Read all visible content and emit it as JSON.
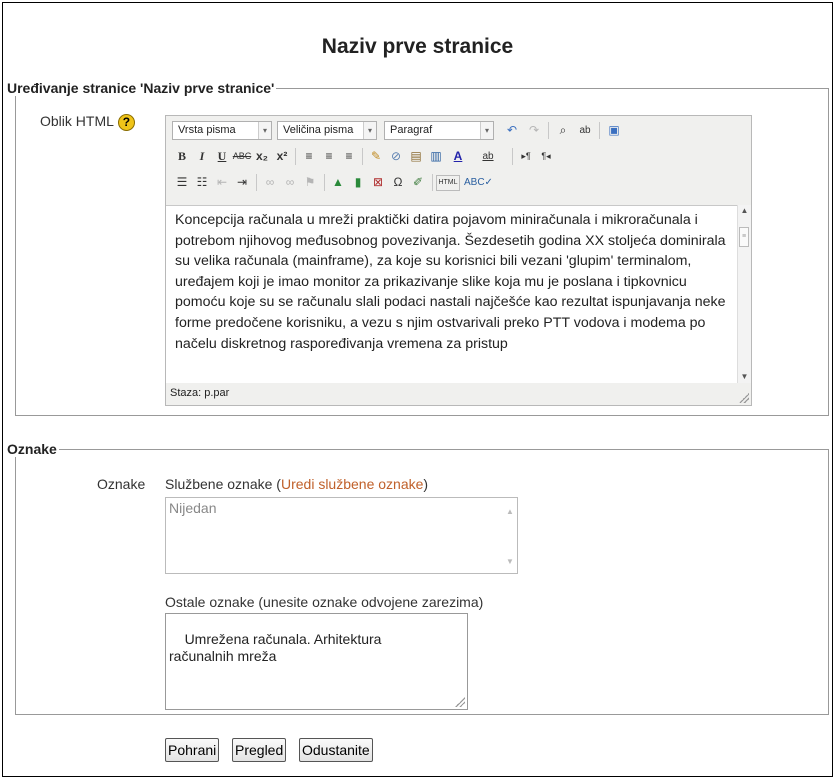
{
  "page_title": "Naziv prve stranice",
  "edit_section": {
    "legend": "Uređivanje stranice 'Naziv prve stranice'",
    "format_label": "Oblik HTML",
    "help_icon": "question-mark-icon",
    "toolbar": {
      "font_family": "Vrsta pisma",
      "font_size": "Veličina pisma",
      "block_format": "Paragraf"
    },
    "content": "Koncepcija računala u mreži praktički datira pojavom miniračunala i mikroračunala i potrebom njihovog međusobnog povezivanja. Šezdesetih godina XX stoljeća dominirala su velika računala (mainframe), za koje su korisnici bili vezani 'glupim' terminalom, uređajem koji je imao monitor za prikazivanje slike koja mu je poslana i tipkovnicu pomoću koje su se računalu slali podaci nastali najčešće kao rezultat ispunjavanja neke forme predočene korisniku, a vezu s njim ostvarivali preko PTT vodova i modema po načelu diskretnog raspoređivanja vremena za pristup",
    "status_path": "Staza: p.par"
  },
  "tags_section": {
    "legend": "Oznake",
    "label": "Oznake",
    "official_prefix": "Službene oznake (",
    "official_link": "Uredi službene oznake",
    "official_suffix": ")",
    "official_value": "Nijedan",
    "other_label": "Ostale oznake (unesite oznake odvojene zarezima)",
    "other_value": "Umrežena računala. Arhitektura\nračunalnih mreža"
  },
  "buttons": {
    "save": "Pohrani",
    "preview": "Pregled",
    "cancel": "Odustanite"
  },
  "colors": {
    "link": "#c0602a",
    "help_icon": "#f0c419"
  }
}
